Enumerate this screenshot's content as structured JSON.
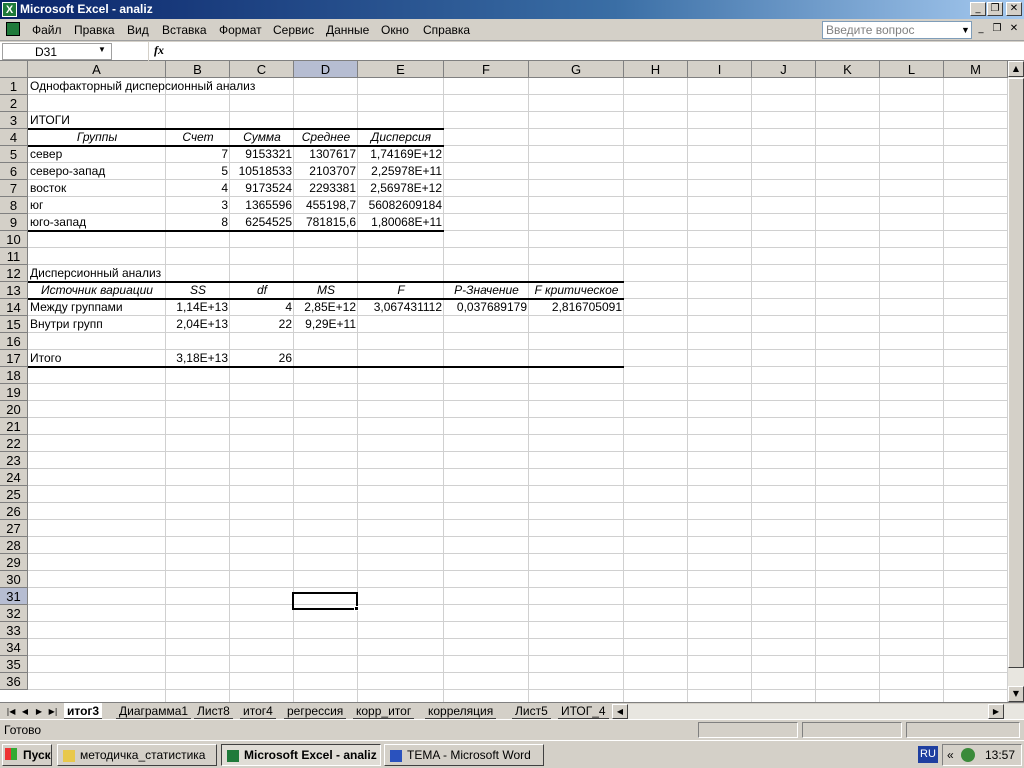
{
  "window": {
    "title": "Microsoft Excel - analiz",
    "minimize": "_",
    "restore": "❐",
    "close": "✕"
  },
  "menu": {
    "items": [
      "Файл",
      "Правка",
      "Вид",
      "Вставка",
      "Формат",
      "Сервис",
      "Данные",
      "Окно",
      "Справка"
    ],
    "question_placeholder": "Введите вопрос"
  },
  "formula_bar": {
    "name_box": "D31",
    "fx": "fx",
    "formula": ""
  },
  "columns": [
    "A",
    "B",
    "C",
    "D",
    "E",
    "F",
    "G",
    "H",
    "I",
    "J",
    "K",
    "L",
    "M"
  ],
  "rows": [
    "1",
    "2",
    "3",
    "4",
    "5",
    "6",
    "7",
    "8",
    "9",
    "10",
    "11",
    "12",
    "13",
    "14",
    "15",
    "16",
    "17",
    "18",
    "19",
    "20",
    "21",
    "22",
    "23",
    "24",
    "25",
    "26",
    "27",
    "28",
    "29",
    "30",
    "31",
    "32",
    "33",
    "34",
    "35",
    "36"
  ],
  "selected": {
    "column": "D",
    "row": "31"
  },
  "sheet": {
    "title": "Однофакторный дисперсионный анализ",
    "summary_label": "ИТОГИ",
    "summary_headers": [
      "Группы",
      "Счет",
      "Сумма",
      "Среднее",
      "Дисперсия"
    ],
    "summary_rows": [
      [
        "север",
        "7",
        "9153321",
        "1307617",
        "1,74169E+12"
      ],
      [
        "северо-запад",
        "5",
        "10518533",
        "2103707",
        "2,25978E+11"
      ],
      [
        "восток",
        "4",
        "9173524",
        "2293381",
        "2,56978E+12"
      ],
      [
        "юг",
        "3",
        "1365596",
        "455198,7",
        "56082609184"
      ],
      [
        "юго-запад",
        "8",
        "6254525",
        "781815,6",
        "1,80068E+11"
      ]
    ],
    "anova_label": "Дисперсионный анализ",
    "anova_headers": [
      "Источник вариации",
      "SS",
      "df",
      "MS",
      "F",
      "P-Значение",
      "F критическое"
    ],
    "anova_rows": [
      [
        "Между группами",
        "1,14E+13",
        "4",
        "2,85E+12",
        "3,067431112",
        "0,037689179",
        "2,816705091"
      ],
      [
        "Внутри групп",
        "2,04E+13",
        "22",
        "9,29E+11",
        "",
        "",
        ""
      ]
    ],
    "total_row": [
      "Итого",
      "3,18E+13",
      "26"
    ]
  },
  "tabs": [
    "итог3",
    "Диаграмма1",
    "Лист8",
    "итог4",
    "регрессия",
    "корр_итог",
    "корреляция",
    "Лист5",
    "ИТОГ_4"
  ],
  "active_tab": "итог3",
  "status": "Готово",
  "taskbar": {
    "start": "Пуск",
    "buttons": [
      "методичка_статистика",
      "Microsoft Excel - analiz",
      "TEMA - Microsoft Word"
    ],
    "active_button": "Microsoft Excel - analiz",
    "language": "RU",
    "time": "13:57"
  }
}
